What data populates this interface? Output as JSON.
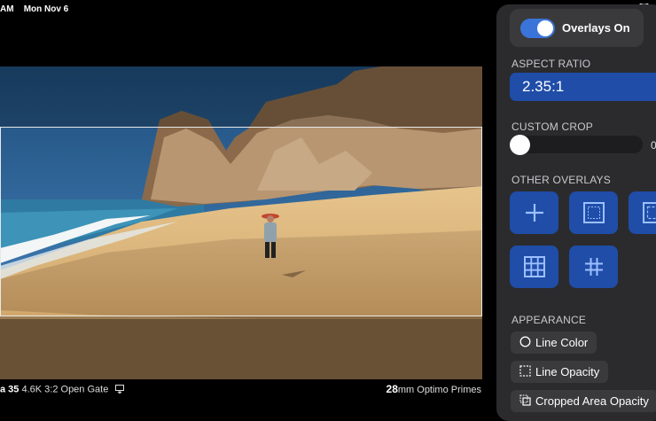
{
  "status": {
    "time": "AM",
    "date": "Mon Nov 6",
    "battery": "9"
  },
  "viewer": {
    "camera_name": "a 35",
    "camera_format": " 4.6K 3:2 Open Gate",
    "focal_length": "28",
    "lens_name": "mm Optimo Primes",
    "aspect_ratio_value": 2.35
  },
  "panel": {
    "overlays_toggle_label": "Overlays On",
    "overlays_on": true,
    "aspect_ratio_label": "ASPECT RATIO",
    "aspect_ratio_value": "2.35:1",
    "custom_crop_label": "CUSTOM CROP",
    "custom_crop_value": "0",
    "custom_crop_level": 0,
    "other_overlays_label": "OTHER OVERLAYS",
    "overlay_buttons": [
      {
        "name": "center-cross",
        "icon": "plus-icon"
      },
      {
        "name": "safe-area",
        "icon": "safe-area-icon"
      },
      {
        "name": "action-safe",
        "icon": "frame-corners-icon"
      },
      {
        "name": "grid-thirds",
        "icon": "grid-icon"
      },
      {
        "name": "grid-hash",
        "icon": "hash-icon"
      }
    ],
    "appearance_label": "APPEARANCE",
    "appearance_options": [
      {
        "label": "Line Color",
        "icon": "circle-icon"
      },
      {
        "label": "Line Opacity",
        "icon": "dashed-square-icon"
      },
      {
        "label": "Cropped Area Opacity",
        "icon": "stacked-squares-icon"
      }
    ]
  },
  "colors": {
    "accent": "#1f4da8",
    "toggle": "#3b74d8",
    "panel_bg": "#2b2b2e"
  }
}
